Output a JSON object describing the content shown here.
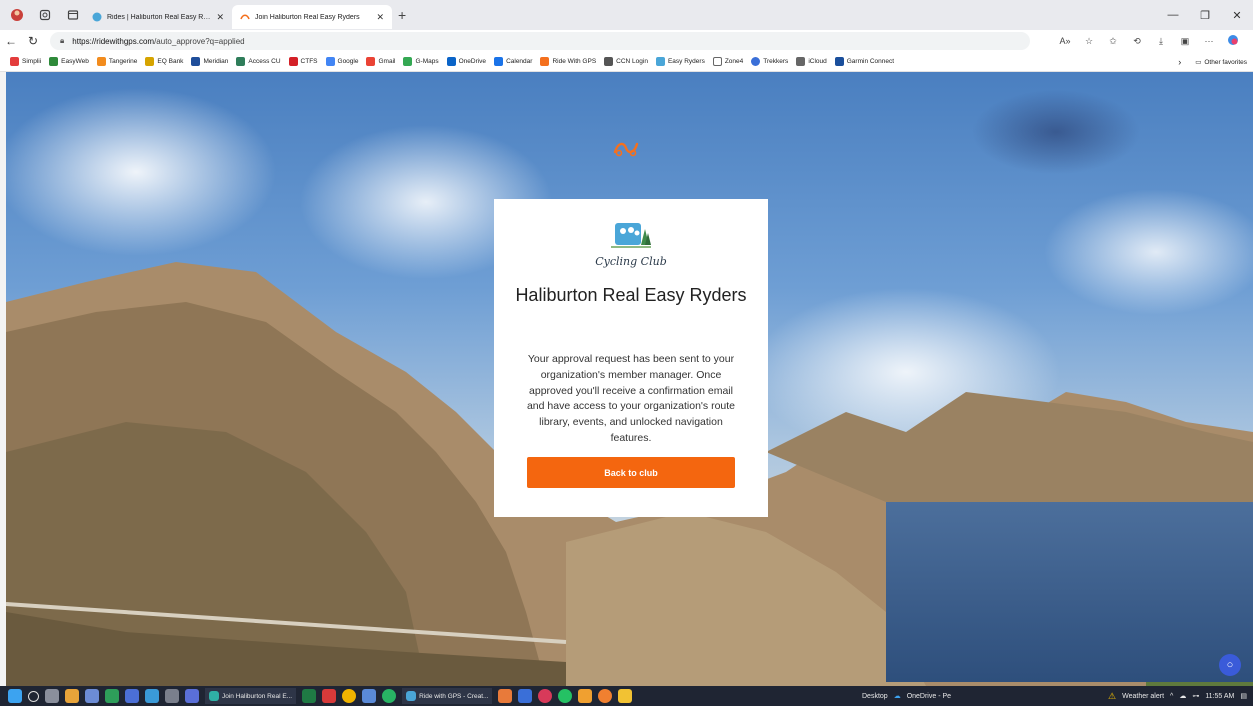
{
  "browser": {
    "tabs": [
      {
        "title": "Rides | Haliburton Real Easy Ryde",
        "active": false
      },
      {
        "title": "Join Haliburton Real Easy Ryders",
        "active": true
      }
    ],
    "url_host": "https://ridewithgps.com",
    "url_path": "/auto_approve?q=applied",
    "bookmarks": [
      "Simplii",
      "EasyWeb",
      "Tangerine",
      "EQ Bank",
      "Meridian",
      "Access CU",
      "CTFS",
      "Google",
      "Gmail",
      "G-Maps",
      "OneDrive",
      "Calendar",
      "Ride With GPS",
      "CCN Login",
      "Easy Ryders",
      "Zone4",
      "Trekkers",
      "iCloud",
      "Garmin Connect"
    ],
    "other_favorites": "Other favorites"
  },
  "card": {
    "logo_text": "Cycling Club",
    "title": "Haliburton Real Easy Ryders",
    "message": "Your approval request has been sent to your organization's member manager. Once approved you'll receive a confirmation email and have access to your organization's route library, events, and unlocked navigation features.",
    "button_label": "Back to club"
  },
  "taskbar": {
    "apps": [
      "Join Haliburton Real E...",
      "Ride with GPS - Creat..."
    ],
    "desktop": "Desktop",
    "onedrive": "OneDrive - Pe",
    "weather": "Weather alert",
    "time": "11:55 AM"
  },
  "colors": {
    "accent": "#f4660f",
    "taskbar": "#1f2533"
  }
}
